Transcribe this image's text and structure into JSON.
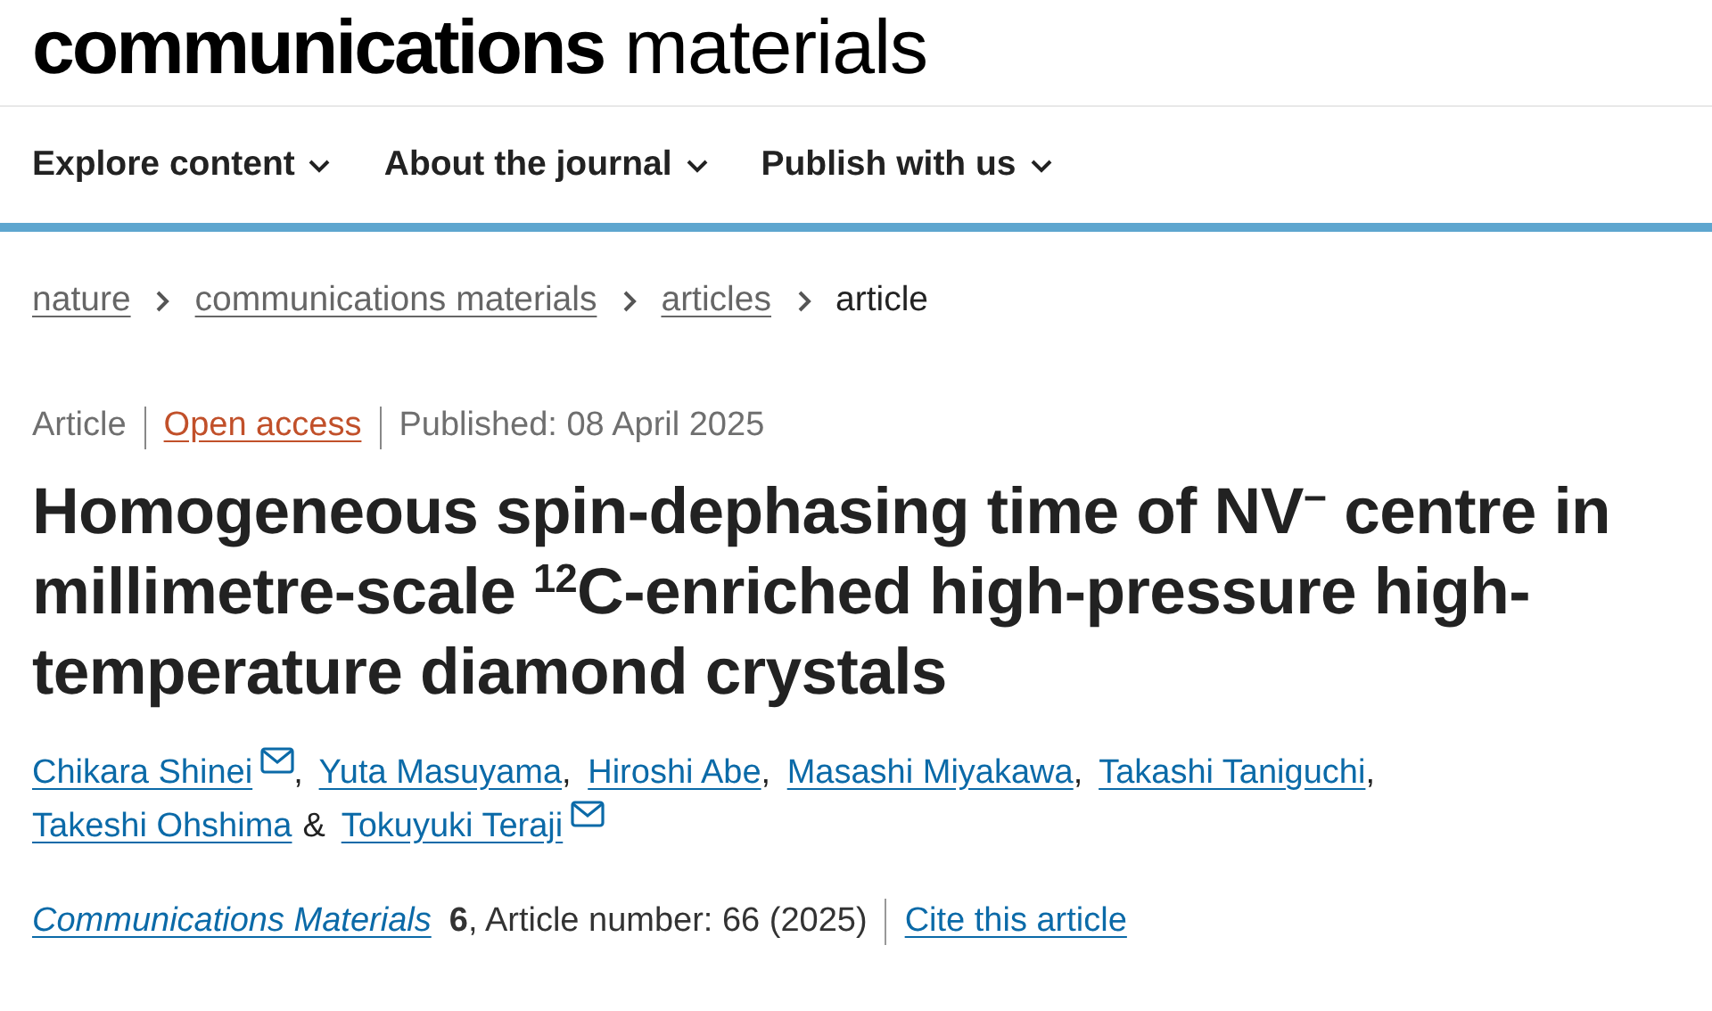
{
  "logo": {
    "strong": "communications",
    "light": "materials"
  },
  "nav": [
    {
      "label": "Explore content"
    },
    {
      "label": "About the journal"
    },
    {
      "label": "Publish with us"
    }
  ],
  "breadcrumb": [
    {
      "label": "nature",
      "link": true
    },
    {
      "label": "communications materials",
      "link": true
    },
    {
      "label": "articles",
      "link": true
    },
    {
      "label": "article",
      "link": false
    }
  ],
  "meta": {
    "type": "Article",
    "access": "Open access",
    "published": "Published: 08 April 2025"
  },
  "title": "Homogeneous spin-dephasing time of NV$^{−}$ centre in millimetre-scale $^{12}$C-enriched high-pressure high-temperature diamond crystals",
  "authors": [
    {
      "name": "Chikara Shinei",
      "email": true,
      "separator": ","
    },
    {
      "name": "Yuta Masuyama",
      "email": false,
      "separator": ","
    },
    {
      "name": "Hiroshi Abe",
      "email": false,
      "separator": ","
    },
    {
      "name": "Masashi Miyakawa",
      "email": false,
      "separator": ","
    },
    {
      "name": "Takashi Taniguchi",
      "email": false,
      "separator": ","
    },
    {
      "name": "Takeshi Ohshima",
      "email": false,
      "separator": "&"
    },
    {
      "name": "Tokuyuki Teraji",
      "email": true
    }
  ],
  "citation": {
    "journal": "Communications Materials",
    "details": "**6**, Article number: 66 (2025)",
    "cite": "Cite this article"
  }
}
